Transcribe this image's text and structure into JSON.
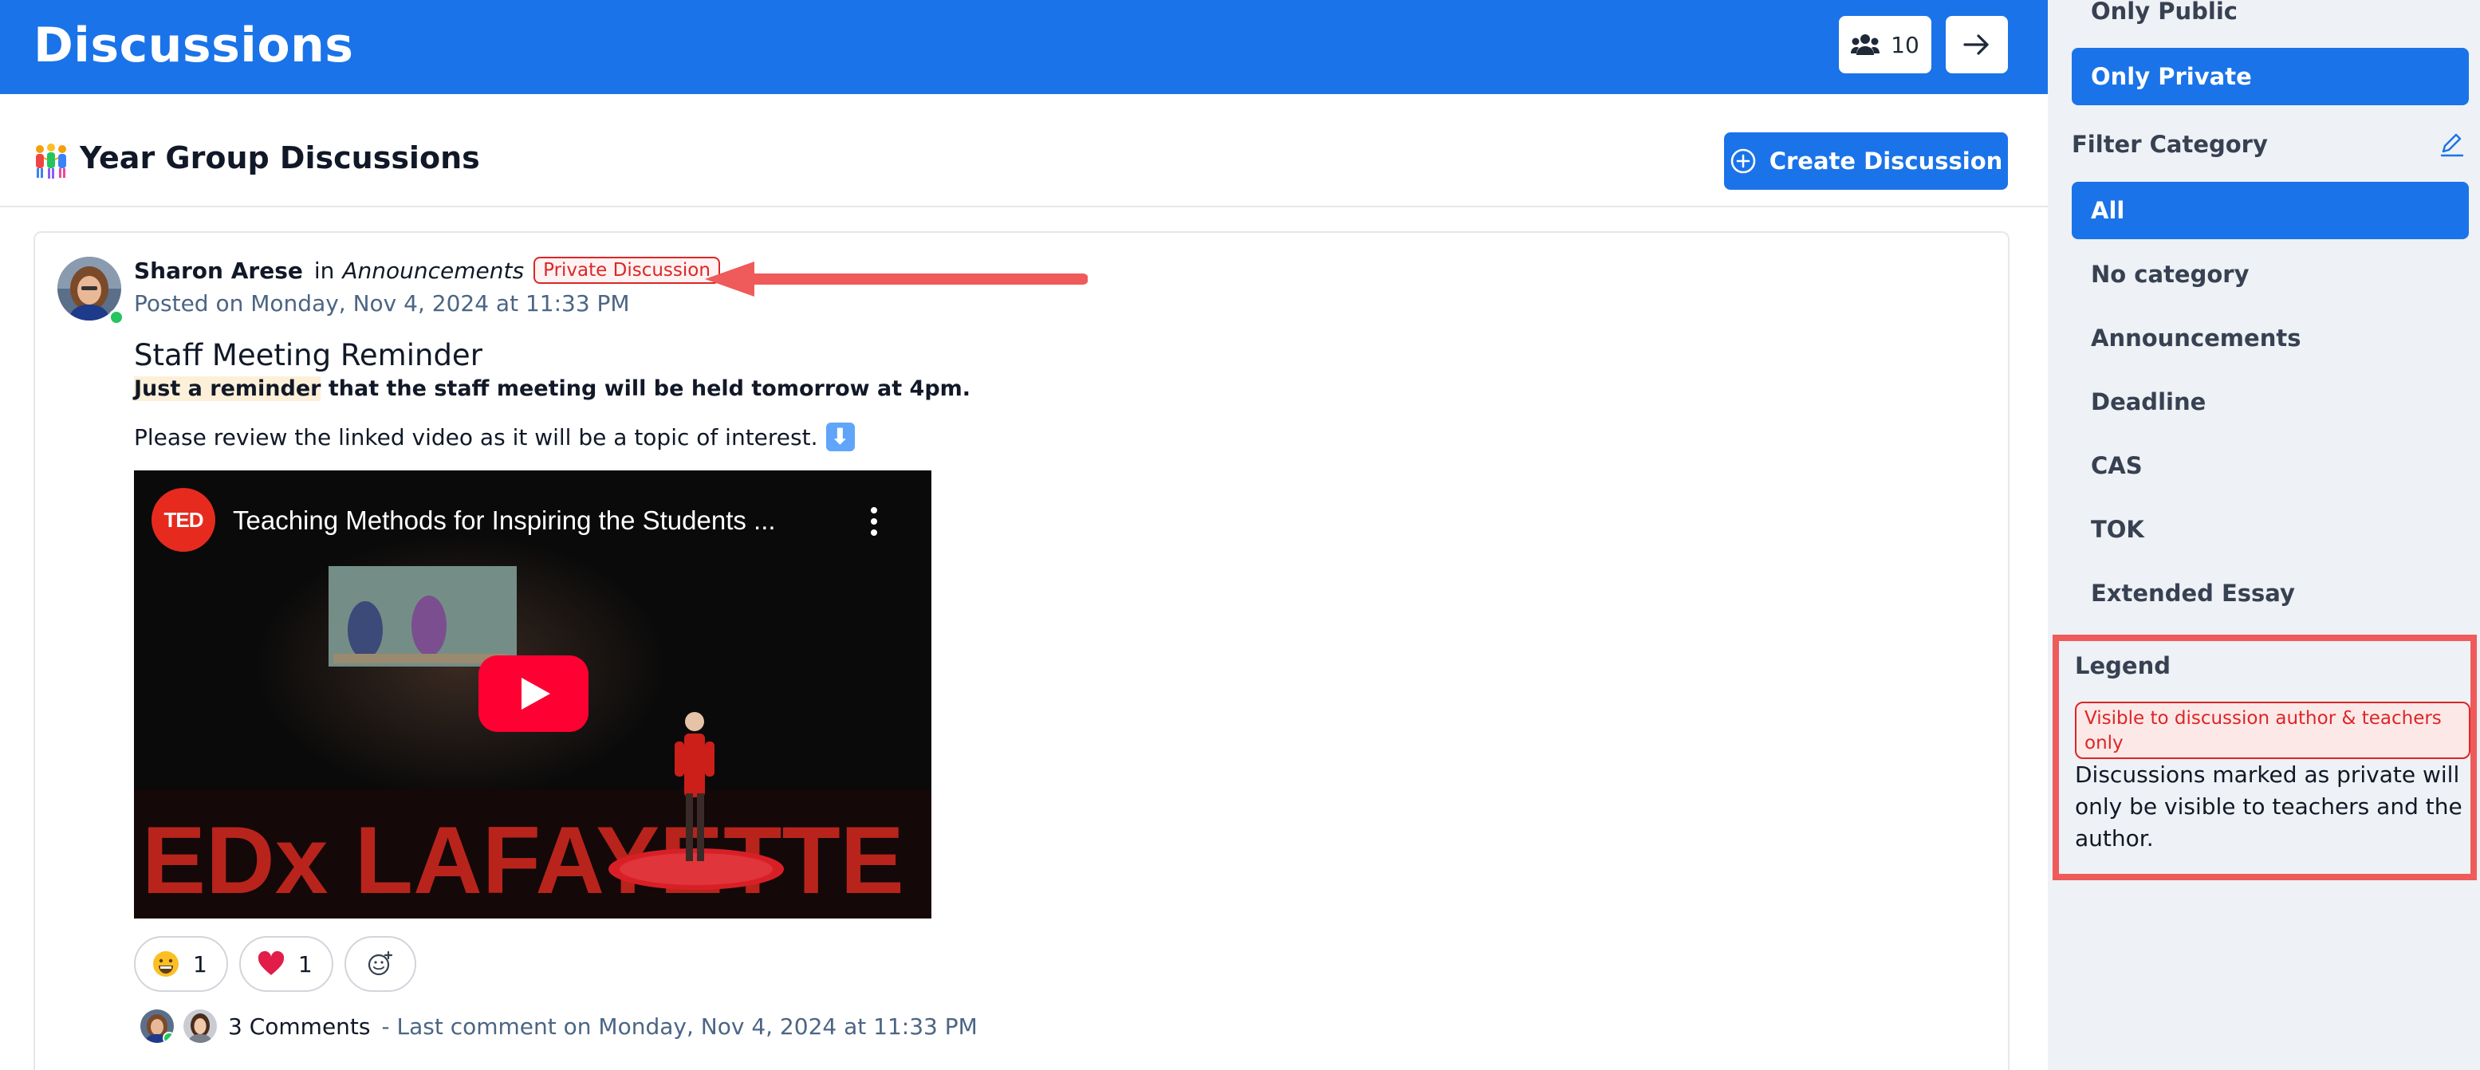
{
  "header": {
    "title": "Discussions",
    "members_count": "10"
  },
  "group": {
    "title": "Year Group Discussions",
    "create_label": "Create Discussion"
  },
  "post": {
    "author": "Sharon Arese",
    "in_word": "in",
    "category": "Announcements",
    "private_badge": "Private Discussion",
    "posted_on": "Posted on Monday, Nov 4, 2024 at 11:33 PM",
    "title": "Staff Meeting Reminder",
    "body_highlight": "Just a reminder",
    "body_bold_rest": " that the staff meeting will be held tomorrow at 4pm.",
    "body_line2": "Please review the linked video as it will be a topic of interest.",
    "down_emoji": "⬇"
  },
  "video": {
    "logo_text": "TED",
    "title": "Teaching Methods for Inspiring the Students ...",
    "stage_text": "EDx LAFAYETTE"
  },
  "reactions": [
    {
      "emoji": "grinning-face-icon",
      "count": "1"
    },
    {
      "emoji": "red-heart-icon",
      "count": "1"
    }
  ],
  "comments": {
    "count_label": "3 Comments",
    "last_comment": "- Last comment on Monday, Nov 4, 2024 at 11:33 PM"
  },
  "sidebar": {
    "visibility_filters": [
      {
        "label": "Only Public",
        "active": false
      },
      {
        "label": "Only Private",
        "active": true
      }
    ],
    "filter_category_label": "Filter Category",
    "categories": [
      {
        "label": "All",
        "active": true
      },
      {
        "label": "No category",
        "active": false
      },
      {
        "label": "Announcements",
        "active": false
      },
      {
        "label": "Deadline",
        "active": false
      },
      {
        "label": "CAS",
        "active": false
      },
      {
        "label": "TOK",
        "active": false
      },
      {
        "label": "Extended Essay",
        "active": false
      }
    ],
    "legend": {
      "title": "Legend",
      "badge": "Visible to discussion author & teachers only",
      "description": "Discussions marked as private will only be visible to teachers and the author."
    }
  },
  "colors": {
    "brand_blue": "#1a73e8",
    "private_red": "#dc2626",
    "annotation_red": "#ef5a5a",
    "muted_text": "#4b6584",
    "sidebar_bg": "#eef1f5"
  }
}
